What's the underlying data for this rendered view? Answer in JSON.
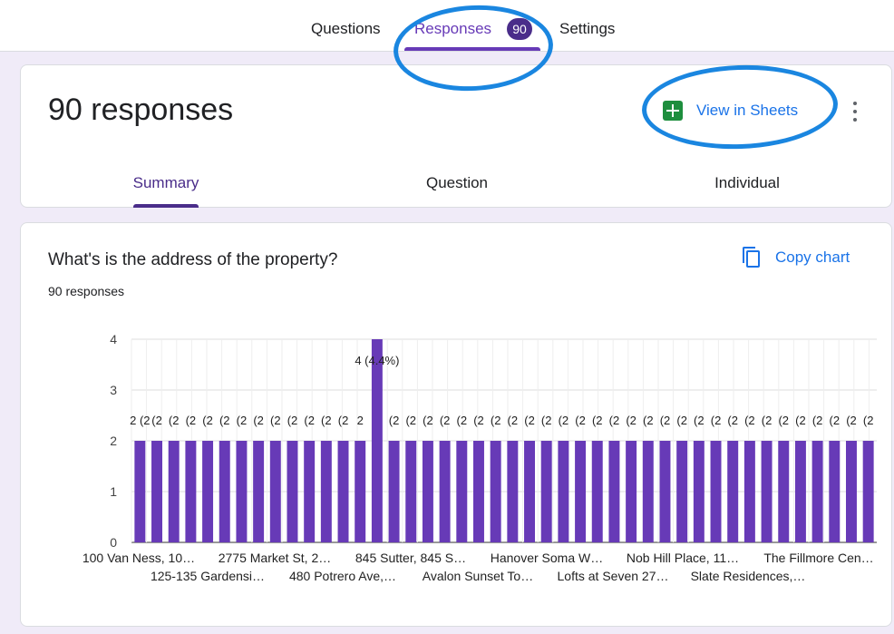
{
  "top_tabs": {
    "questions": "Questions",
    "responses": "Responses",
    "responses_badge": "90",
    "settings": "Settings"
  },
  "summary": {
    "title": "90 responses",
    "view_in_sheets": "View in Sheets",
    "tabs": [
      "Summary",
      "Question",
      "Individual"
    ]
  },
  "question": {
    "title": "What's is the address of the property?",
    "count": "90 responses",
    "copy_label": "Copy chart"
  },
  "colors": {
    "accent": "#673ab7",
    "bar": "#673ab7",
    "link": "#1a73e8",
    "annotation": "#1a86e0"
  },
  "chart_data": {
    "type": "bar",
    "ylim": [
      0,
      4
    ],
    "yticks": [
      "0",
      "1",
      "2",
      "3",
      "4"
    ],
    "values": [
      2,
      2,
      2,
      2,
      2,
      2,
      2,
      2,
      2,
      2,
      2,
      2,
      2,
      2,
      4,
      2,
      2,
      2,
      2,
      2,
      2,
      2,
      2,
      2,
      2,
      2,
      2,
      2,
      2,
      2,
      2,
      2,
      2,
      2,
      2,
      2,
      2,
      2,
      2,
      2,
      2,
      2,
      2,
      2
    ],
    "value_labels": [
      "2 (2",
      "(2",
      "(2",
      "(2",
      "(2",
      "(2",
      "(2",
      "(2",
      "(2",
      "(2",
      "(2",
      "(2",
      "(2",
      "2",
      "4 (4.4%)",
      "(2",
      "(2",
      "(2",
      "(2",
      "(2",
      "(2",
      "(2",
      "(2",
      "(2",
      "(2",
      "(2",
      "(2",
      "(2",
      "(2",
      "(2",
      "(2",
      "(2",
      "(2",
      "(2",
      "(2",
      "(2",
      "(2",
      "(2",
      "(2",
      "(2",
      "(2",
      "(2",
      "(2",
      "(2"
    ],
    "xlabels_row1": [
      "100 Van Ness, 10…",
      "2775 Market St, 2…",
      "845 Sutter, 845 S…",
      "Hanover Soma W…",
      "Nob Hill Place, 11…",
      "The Fillmore Cen…"
    ],
    "xlabels_row2": [
      "125-135 Gardensi…",
      "480 Potrero Ave,…",
      "Avalon Sunset To…",
      "Lofts at Seven 27…",
      "Slate Residences,…"
    ]
  }
}
